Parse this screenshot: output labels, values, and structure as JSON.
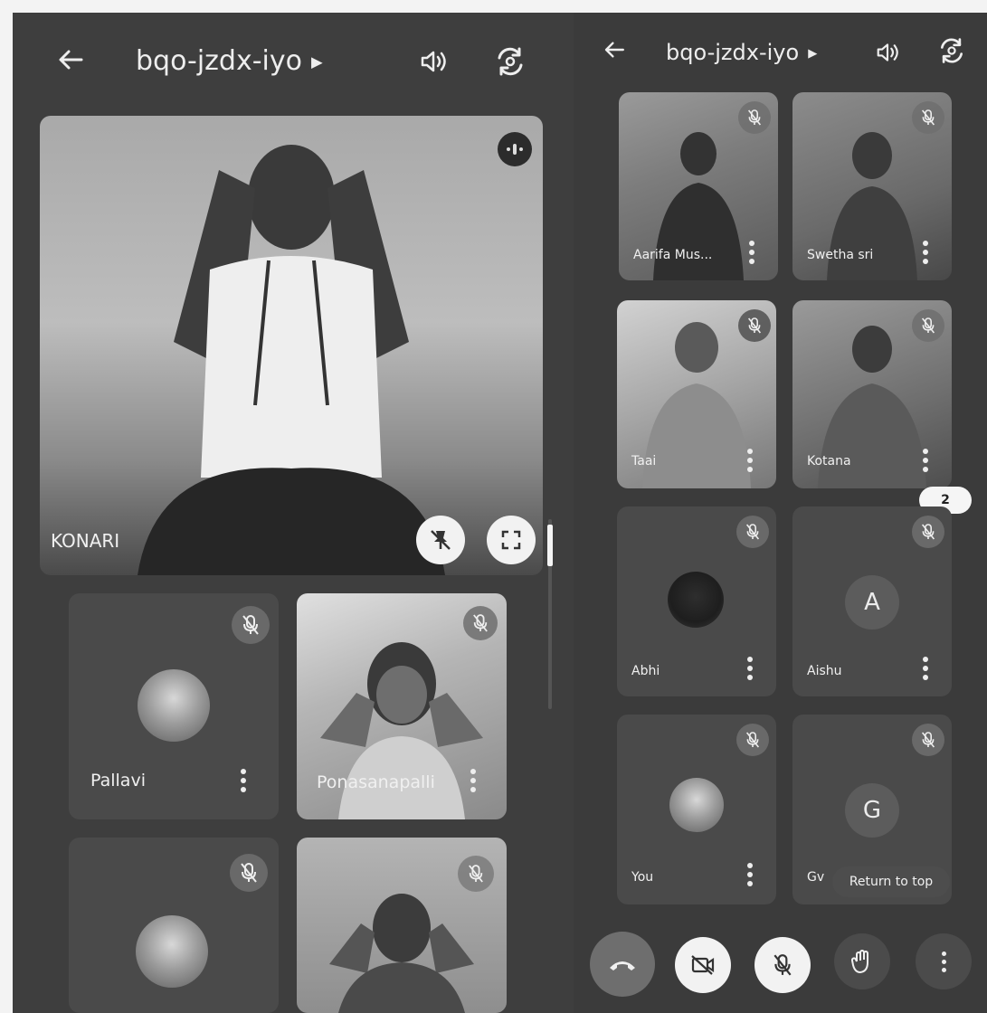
{
  "meeting_code": "bqo-jzdx-iyo",
  "left_screen": {
    "featured": {
      "name": "KONARI"
    },
    "tiles": [
      {
        "name": "Pallavi"
      },
      {
        "name": "Ponasanapalli"
      },
      {
        "name": ""
      },
      {
        "name": ""
      }
    ]
  },
  "right_screen": {
    "tiles": [
      {
        "name": "Aarifa Mus..."
      },
      {
        "name": "Swetha sri"
      },
      {
        "name": "Taai"
      },
      {
        "name": "Kotana"
      },
      {
        "name": "Abhi"
      },
      {
        "name": "Aishu",
        "avatar_letter": "A"
      },
      {
        "name": "You"
      },
      {
        "name": "Gv",
        "avatar_letter": "G"
      }
    ],
    "badge_count": "2",
    "return_to_top_label": "Return to top"
  },
  "icons": {
    "back": "arrow-left-icon",
    "dropdown": "triangle-right-icon",
    "speaker": "speaker-icon",
    "switch_camera": "switch-camera-icon",
    "mic_off": "mic-off-icon",
    "more": "more-vert-icon",
    "unpin": "pin-off-icon",
    "fullscreen": "fullscreen-icon",
    "spotlight": "spotlight-icon",
    "end_call": "phone-hangup-icon",
    "camera_off": "videocam-off-icon",
    "raise_hand": "hand-icon"
  },
  "colors": {
    "background": "#3d3d3d",
    "tile": "#4a4a4a",
    "end_call": "#6e6e6e"
  }
}
